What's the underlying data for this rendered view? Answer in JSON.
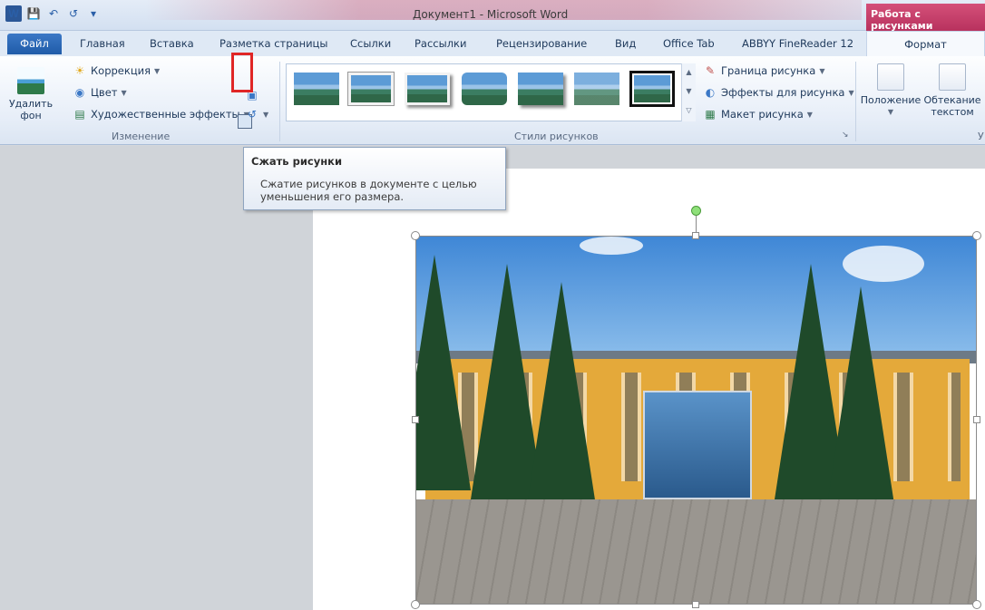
{
  "window": {
    "title": "Документ1 - Microsoft Word",
    "context_tab": "Работа с рисунками",
    "app_icon": "W"
  },
  "qat": {
    "save": "save-icon",
    "undo": "undo-icon",
    "redo": "redo-icon",
    "customize": "customize-icon"
  },
  "tabs": {
    "file": "Файл",
    "items": [
      "Главная",
      "Вставка",
      "Разметка страницы",
      "Ссылки",
      "Рассылки",
      "Рецензирование",
      "Вид",
      "Office Tab",
      "ABBYY FineReader 12"
    ],
    "format": "Формат"
  },
  "ribbon": {
    "remove_bg": "Удалить фон",
    "correction": "Коррекция",
    "color": "Цвет",
    "artistic": "Художественные эффекты",
    "group_change": "Изменение",
    "group_styles": "Стили рисунков",
    "border": "Граница рисунка",
    "effects": "Эффекты для рисунка",
    "layout": "Макет рисунка",
    "position": "Положение",
    "wrap": "Обтекание текстом",
    "group_arrange": "У"
  },
  "tooltip": {
    "title": "Сжать рисунки",
    "body": "Сжатие рисунков в документе с целью уменьшения его размера."
  },
  "colors": {
    "file_tab": "#2b6cc0",
    "context_tab": "#c8416b",
    "highlight": "#e02626"
  }
}
